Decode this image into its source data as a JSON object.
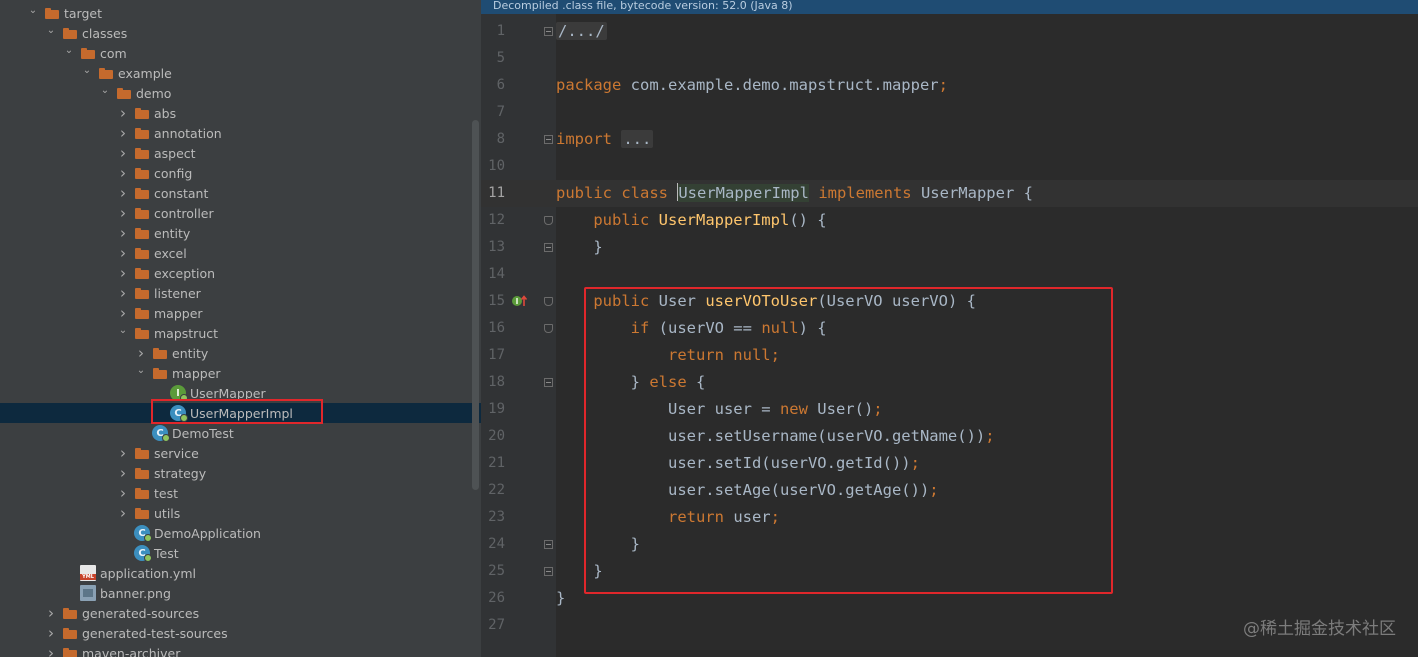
{
  "project_tree": {
    "items": [
      {
        "label": "target",
        "depth": 1,
        "expanded": true,
        "icon": "folder-icon"
      },
      {
        "label": "classes",
        "depth": 2,
        "expanded": true,
        "icon": "folder-icon"
      },
      {
        "label": "com",
        "depth": 3,
        "expanded": true,
        "icon": "folder-icon"
      },
      {
        "label": "example",
        "depth": 4,
        "expanded": true,
        "icon": "folder-icon"
      },
      {
        "label": "demo",
        "depth": 5,
        "expanded": true,
        "icon": "folder-icon"
      },
      {
        "label": "abs",
        "depth": 6,
        "expanded": false,
        "icon": "folder-icon"
      },
      {
        "label": "annotation",
        "depth": 6,
        "expanded": false,
        "icon": "folder-icon"
      },
      {
        "label": "aspect",
        "depth": 6,
        "expanded": false,
        "icon": "folder-icon"
      },
      {
        "label": "config",
        "depth": 6,
        "expanded": false,
        "icon": "folder-icon"
      },
      {
        "label": "constant",
        "depth": 6,
        "expanded": false,
        "icon": "folder-icon"
      },
      {
        "label": "controller",
        "depth": 6,
        "expanded": false,
        "icon": "folder-icon"
      },
      {
        "label": "entity",
        "depth": 6,
        "expanded": false,
        "icon": "folder-icon"
      },
      {
        "label": "excel",
        "depth": 6,
        "expanded": false,
        "icon": "folder-icon"
      },
      {
        "label": "exception",
        "depth": 6,
        "expanded": false,
        "icon": "folder-icon"
      },
      {
        "label": "listener",
        "depth": 6,
        "expanded": false,
        "icon": "folder-icon"
      },
      {
        "label": "mapper",
        "depth": 6,
        "expanded": false,
        "icon": "folder-icon"
      },
      {
        "label": "mapstruct",
        "depth": 6,
        "expanded": true,
        "icon": "folder-icon"
      },
      {
        "label": "entity",
        "depth": 7,
        "expanded": false,
        "icon": "folder-icon"
      },
      {
        "label": "mapper",
        "depth": 7,
        "expanded": true,
        "icon": "folder-icon"
      },
      {
        "label": "UserMapper",
        "depth": 8,
        "icon": "interface-icon"
      },
      {
        "label": "UserMapperImpl",
        "depth": 8,
        "icon": "class-icon",
        "selected": true
      },
      {
        "label": "DemoTest",
        "depth": 7,
        "icon": "class-icon"
      },
      {
        "label": "service",
        "depth": 6,
        "expanded": false,
        "icon": "folder-icon"
      },
      {
        "label": "strategy",
        "depth": 6,
        "expanded": false,
        "icon": "folder-icon"
      },
      {
        "label": "test",
        "depth": 6,
        "expanded": false,
        "icon": "folder-icon"
      },
      {
        "label": "utils",
        "depth": 6,
        "expanded": false,
        "icon": "folder-icon"
      },
      {
        "label": "DemoApplication",
        "depth": 6,
        "icon": "class-icon"
      },
      {
        "label": "Test",
        "depth": 6,
        "icon": "class-icon"
      },
      {
        "label": "application.yml",
        "depth": 3,
        "icon": "yml-icon"
      },
      {
        "label": "banner.png",
        "depth": 3,
        "icon": "png-icon"
      },
      {
        "label": "generated-sources",
        "depth": 2,
        "expanded": false,
        "icon": "folder-icon"
      },
      {
        "label": "generated-test-sources",
        "depth": 2,
        "expanded": false,
        "icon": "folder-icon"
      },
      {
        "label": "maven-archiver",
        "depth": 2,
        "expanded": false,
        "icon": "folder-icon"
      }
    ]
  },
  "editor": {
    "banner": "Decompiled .class file, bytecode version: 52.0 (Java 8)",
    "current_line": "11",
    "lines": [
      {
        "num": "1",
        "tokens": [
          {
            "t": "/.../",
            "c": "folded"
          }
        ],
        "fold": "box"
      },
      {
        "num": "5",
        "tokens": []
      },
      {
        "num": "6",
        "tokens": [
          {
            "t": "package ",
            "c": "kw"
          },
          {
            "t": "com.example.demo.mapstruct.mapper",
            "c": "plain"
          },
          {
            "t": ";",
            "c": "kw"
          }
        ]
      },
      {
        "num": "7",
        "tokens": []
      },
      {
        "num": "8",
        "tokens": [
          {
            "t": "import ",
            "c": "kw"
          },
          {
            "t": "...",
            "c": "folded"
          }
        ],
        "fold": "box"
      },
      {
        "num": "10",
        "tokens": []
      },
      {
        "num": "11",
        "tokens": [
          {
            "t": "public class ",
            "c": "kw"
          },
          {
            "t": "|",
            "c": "caret"
          },
          {
            "t": "UserMapperImpl",
            "c": "impl-highlight"
          },
          {
            "t": " implements ",
            "c": "kw"
          },
          {
            "t": "UserMapper {",
            "c": "plain"
          }
        ]
      },
      {
        "num": "12",
        "tokens": [
          {
            "t": "    public ",
            "c": "kw"
          },
          {
            "t": "UserMapperImpl",
            "c": "fn"
          },
          {
            "t": "() {",
            "c": "plain"
          }
        ],
        "fold": "shield"
      },
      {
        "num": "13",
        "tokens": [
          {
            "t": "    }",
            "c": "plain"
          }
        ],
        "fold": "box"
      },
      {
        "num": "14",
        "tokens": []
      },
      {
        "num": "15",
        "tokens": [
          {
            "t": "    public ",
            "c": "kw"
          },
          {
            "t": "User ",
            "c": "plain"
          },
          {
            "t": "userVOToUser",
            "c": "fn"
          },
          {
            "t": "(UserVO userVO) {",
            "c": "plain"
          }
        ],
        "fold": "shield"
      },
      {
        "num": "16",
        "tokens": [
          {
            "t": "        if ",
            "c": "kw"
          },
          {
            "t": "(userVO == ",
            "c": "plain"
          },
          {
            "t": "null",
            "c": "kw"
          },
          {
            "t": ") {",
            "c": "plain"
          }
        ],
        "fold": "shield"
      },
      {
        "num": "17",
        "tokens": [
          {
            "t": "            return null",
            "c": "kw"
          },
          {
            "t": ";",
            "c": "kw"
          }
        ]
      },
      {
        "num": "18",
        "tokens": [
          {
            "t": "        } ",
            "c": "plain"
          },
          {
            "t": "else ",
            "c": "kw"
          },
          {
            "t": "{",
            "c": "plain"
          }
        ],
        "fold": "box"
      },
      {
        "num": "19",
        "tokens": [
          {
            "t": "            User user = ",
            "c": "plain"
          },
          {
            "t": "new ",
            "c": "kw"
          },
          {
            "t": "User()",
            "c": "plain"
          },
          {
            "t": ";",
            "c": "kw"
          }
        ]
      },
      {
        "num": "20",
        "tokens": [
          {
            "t": "            user.setUsername(userVO.getName())",
            "c": "plain"
          },
          {
            "t": ";",
            "c": "kw"
          }
        ]
      },
      {
        "num": "21",
        "tokens": [
          {
            "t": "            user.setId(userVO.getId())",
            "c": "plain"
          },
          {
            "t": ";",
            "c": "kw"
          }
        ]
      },
      {
        "num": "22",
        "tokens": [
          {
            "t": "            user.setAge(userVO.getAge())",
            "c": "plain"
          },
          {
            "t": ";",
            "c": "kw"
          }
        ]
      },
      {
        "num": "23",
        "tokens": [
          {
            "t": "            return ",
            "c": "kw"
          },
          {
            "t": "user",
            "c": "plain"
          },
          {
            "t": ";",
            "c": "kw"
          }
        ]
      },
      {
        "num": "24",
        "tokens": [
          {
            "t": "        }",
            "c": "plain"
          }
        ],
        "fold": "box"
      },
      {
        "num": "25",
        "tokens": [
          {
            "t": "    }",
            "c": "plain"
          }
        ],
        "fold": "box"
      },
      {
        "num": "26",
        "tokens": [
          {
            "t": "}",
            "c": "plain"
          }
        ]
      },
      {
        "num": "27",
        "tokens": []
      }
    ]
  },
  "watermark": "@稀土掘金技术社区",
  "colors": {
    "highlight_box": "#e0272b",
    "keyword": "#cc7832",
    "function": "#ffc66d",
    "text": "#a9b7c6"
  }
}
